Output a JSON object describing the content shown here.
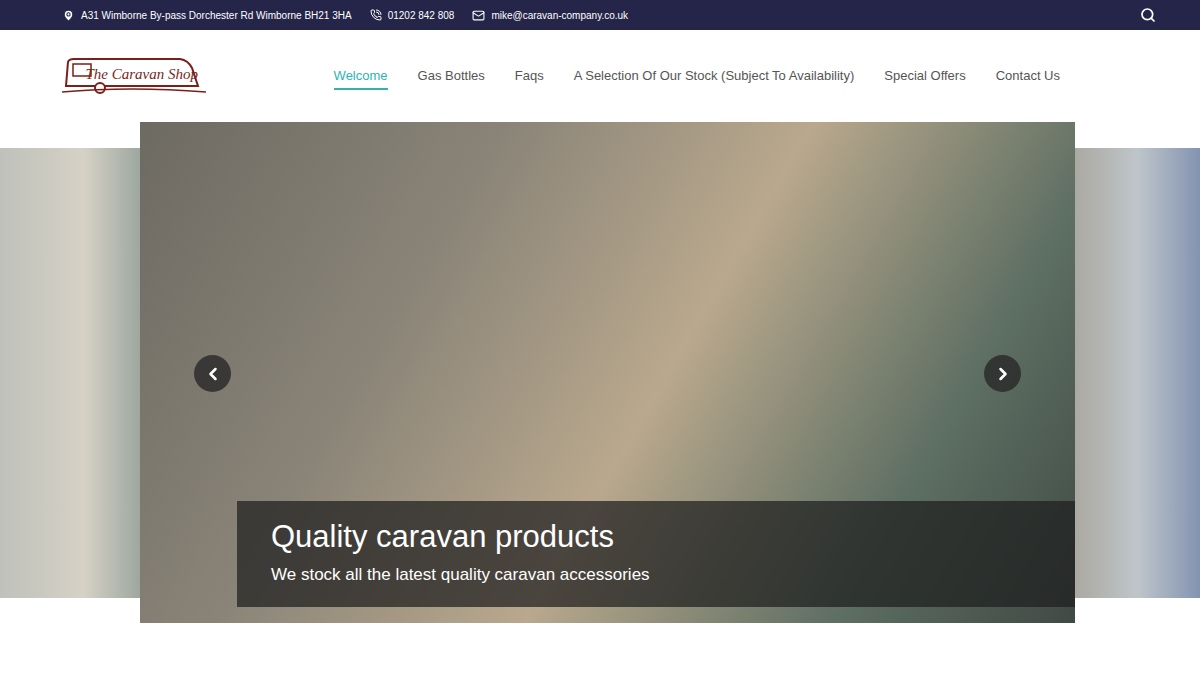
{
  "topbar": {
    "address": "A31 Wimborne By-pass Dorchester Rd Wimborne BH21 3HA",
    "phone": "01202 842 808",
    "email": "mike@caravan-company.co.uk"
  },
  "logo": {
    "text": "The Caravan Shop"
  },
  "nav": [
    {
      "label": "Welcome",
      "selected": true
    },
    {
      "label": "Gas Bottles",
      "selected": false
    },
    {
      "label": "Faqs",
      "selected": false
    },
    {
      "label": "A Selection Of Our Stock (Subject To Availability)",
      "selected": false
    },
    {
      "label": "Special Offers",
      "selected": false
    },
    {
      "label": "Contact Us",
      "selected": false
    }
  ],
  "slider": {
    "title": "Quality caravan products",
    "subtitle": "We stock all the latest quality caravan accessories"
  }
}
